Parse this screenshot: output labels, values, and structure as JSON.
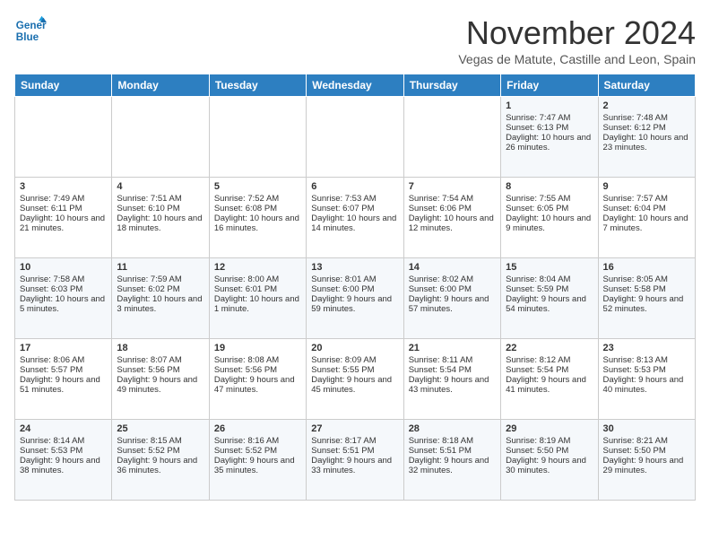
{
  "header": {
    "logo_line1": "General",
    "logo_line2": "Blue",
    "month": "November 2024",
    "location": "Vegas de Matute, Castille and Leon, Spain"
  },
  "days_of_week": [
    "Sunday",
    "Monday",
    "Tuesday",
    "Wednesday",
    "Thursday",
    "Friday",
    "Saturday"
  ],
  "weeks": [
    [
      {
        "day": "",
        "info": ""
      },
      {
        "day": "",
        "info": ""
      },
      {
        "day": "",
        "info": ""
      },
      {
        "day": "",
        "info": ""
      },
      {
        "day": "",
        "info": ""
      },
      {
        "day": "1",
        "info": "Sunrise: 7:47 AM\nSunset: 6:13 PM\nDaylight: 10 hours and 26 minutes."
      },
      {
        "day": "2",
        "info": "Sunrise: 7:48 AM\nSunset: 6:12 PM\nDaylight: 10 hours and 23 minutes."
      }
    ],
    [
      {
        "day": "3",
        "info": "Sunrise: 7:49 AM\nSunset: 6:11 PM\nDaylight: 10 hours and 21 minutes."
      },
      {
        "day": "4",
        "info": "Sunrise: 7:51 AM\nSunset: 6:10 PM\nDaylight: 10 hours and 18 minutes."
      },
      {
        "day": "5",
        "info": "Sunrise: 7:52 AM\nSunset: 6:08 PM\nDaylight: 10 hours and 16 minutes."
      },
      {
        "day": "6",
        "info": "Sunrise: 7:53 AM\nSunset: 6:07 PM\nDaylight: 10 hours and 14 minutes."
      },
      {
        "day": "7",
        "info": "Sunrise: 7:54 AM\nSunset: 6:06 PM\nDaylight: 10 hours and 12 minutes."
      },
      {
        "day": "8",
        "info": "Sunrise: 7:55 AM\nSunset: 6:05 PM\nDaylight: 10 hours and 9 minutes."
      },
      {
        "day": "9",
        "info": "Sunrise: 7:57 AM\nSunset: 6:04 PM\nDaylight: 10 hours and 7 minutes."
      }
    ],
    [
      {
        "day": "10",
        "info": "Sunrise: 7:58 AM\nSunset: 6:03 PM\nDaylight: 10 hours and 5 minutes."
      },
      {
        "day": "11",
        "info": "Sunrise: 7:59 AM\nSunset: 6:02 PM\nDaylight: 10 hours and 3 minutes."
      },
      {
        "day": "12",
        "info": "Sunrise: 8:00 AM\nSunset: 6:01 PM\nDaylight: 10 hours and 1 minute."
      },
      {
        "day": "13",
        "info": "Sunrise: 8:01 AM\nSunset: 6:00 PM\nDaylight: 9 hours and 59 minutes."
      },
      {
        "day": "14",
        "info": "Sunrise: 8:02 AM\nSunset: 6:00 PM\nDaylight: 9 hours and 57 minutes."
      },
      {
        "day": "15",
        "info": "Sunrise: 8:04 AM\nSunset: 5:59 PM\nDaylight: 9 hours and 54 minutes."
      },
      {
        "day": "16",
        "info": "Sunrise: 8:05 AM\nSunset: 5:58 PM\nDaylight: 9 hours and 52 minutes."
      }
    ],
    [
      {
        "day": "17",
        "info": "Sunrise: 8:06 AM\nSunset: 5:57 PM\nDaylight: 9 hours and 51 minutes."
      },
      {
        "day": "18",
        "info": "Sunrise: 8:07 AM\nSunset: 5:56 PM\nDaylight: 9 hours and 49 minutes."
      },
      {
        "day": "19",
        "info": "Sunrise: 8:08 AM\nSunset: 5:56 PM\nDaylight: 9 hours and 47 minutes."
      },
      {
        "day": "20",
        "info": "Sunrise: 8:09 AM\nSunset: 5:55 PM\nDaylight: 9 hours and 45 minutes."
      },
      {
        "day": "21",
        "info": "Sunrise: 8:11 AM\nSunset: 5:54 PM\nDaylight: 9 hours and 43 minutes."
      },
      {
        "day": "22",
        "info": "Sunrise: 8:12 AM\nSunset: 5:54 PM\nDaylight: 9 hours and 41 minutes."
      },
      {
        "day": "23",
        "info": "Sunrise: 8:13 AM\nSunset: 5:53 PM\nDaylight: 9 hours and 40 minutes."
      }
    ],
    [
      {
        "day": "24",
        "info": "Sunrise: 8:14 AM\nSunset: 5:53 PM\nDaylight: 9 hours and 38 minutes."
      },
      {
        "day": "25",
        "info": "Sunrise: 8:15 AM\nSunset: 5:52 PM\nDaylight: 9 hours and 36 minutes."
      },
      {
        "day": "26",
        "info": "Sunrise: 8:16 AM\nSunset: 5:52 PM\nDaylight: 9 hours and 35 minutes."
      },
      {
        "day": "27",
        "info": "Sunrise: 8:17 AM\nSunset: 5:51 PM\nDaylight: 9 hours and 33 minutes."
      },
      {
        "day": "28",
        "info": "Sunrise: 8:18 AM\nSunset: 5:51 PM\nDaylight: 9 hours and 32 minutes."
      },
      {
        "day": "29",
        "info": "Sunrise: 8:19 AM\nSunset: 5:50 PM\nDaylight: 9 hours and 30 minutes."
      },
      {
        "day": "30",
        "info": "Sunrise: 8:21 AM\nSunset: 5:50 PM\nDaylight: 9 hours and 29 minutes."
      }
    ]
  ]
}
